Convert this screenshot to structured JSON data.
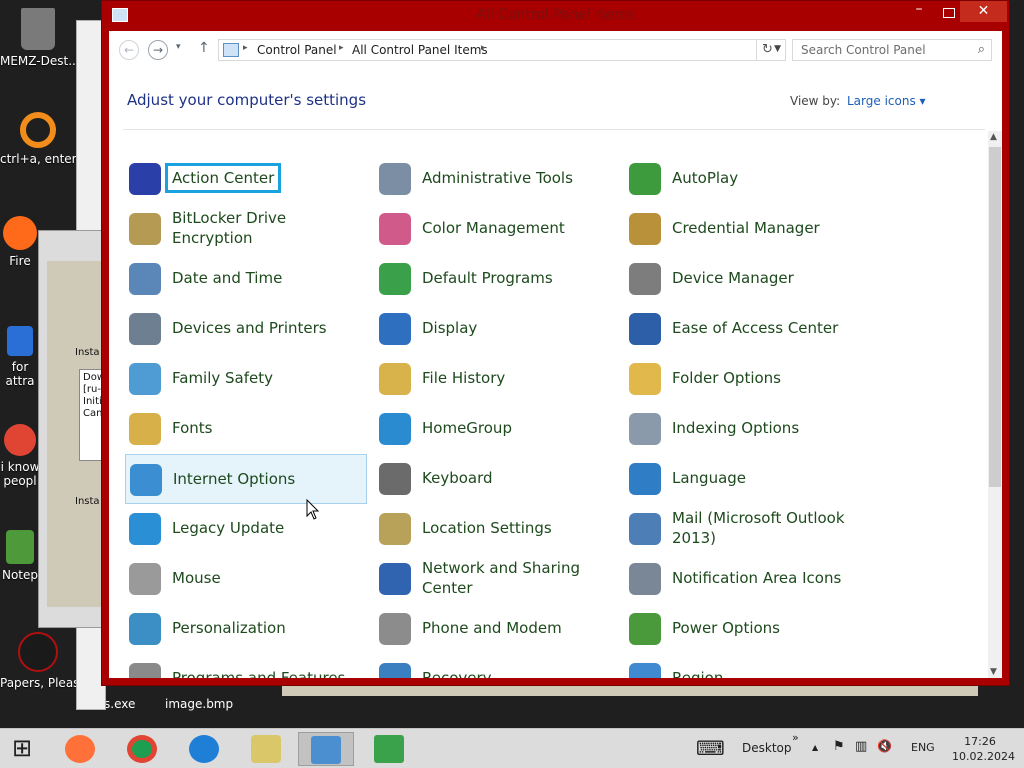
{
  "desktop": {
    "icons": [
      {
        "label": "MEMZ-Dest...",
        "color": "#7a7a7a"
      },
      {
        "label": "ctrl+a, enter",
        "color": "#f28c1b"
      },
      {
        "label": "Fire",
        "color": "#ff6a1a"
      },
      {
        "label": "for attra",
        "color": "#2a6fd6"
      },
      {
        "label": "i know peopl",
        "color": "#e04433"
      },
      {
        "label": "Notep",
        "color": "#4e9a3a"
      },
      {
        "label": "Papers, Please",
        "color": "#1a1a1a"
      }
    ],
    "bottom_files": [
      "s.exe",
      "image.bmp"
    ]
  },
  "installer": {
    "label_top": "Insta",
    "log_lines": [
      "Dow",
      "[ru-",
      "Initi",
      "Can"
    ],
    "label_bottom": "Insta"
  },
  "window": {
    "title": "All Control Panel Items",
    "close_glyph": "✕",
    "minimize_glyph": "–"
  },
  "nav": {
    "back_glyph": "←",
    "forward_glyph": "→",
    "recent_glyph": "▾",
    "up_glyph": "↑",
    "breadcrumbs": [
      "Control Panel",
      "All Control Panel Items"
    ],
    "refresh_glyph": "↻",
    "search_placeholder": "Search Control Panel",
    "search_glyph": "⌕"
  },
  "header": {
    "heading": "Adjust your computer's settings",
    "view_by_label": "View by:",
    "view_by_value": "Large icons ▾"
  },
  "items": [
    {
      "label": "Action Center",
      "color": "#2a3fa8"
    },
    {
      "label": "Administrative Tools",
      "color": "#7c8ea3"
    },
    {
      "label": "AutoPlay",
      "color": "#3d9a3d"
    },
    {
      "label": "BitLocker Drive Encryption",
      "color": "#b59a54"
    },
    {
      "label": "Color Management",
      "color": "#d05a8a"
    },
    {
      "label": "Credential Manager",
      "color": "#b8913a"
    },
    {
      "label": "Date and Time",
      "color": "#5b86b8"
    },
    {
      "label": "Default Programs",
      "color": "#3aa14a"
    },
    {
      "label": "Device Manager",
      "color": "#7d7d7d"
    },
    {
      "label": "Devices and Printers",
      "color": "#6e7f91"
    },
    {
      "label": "Display",
      "color": "#2e6fbf"
    },
    {
      "label": "Ease of Access Center",
      "color": "#2c5fa8"
    },
    {
      "label": "Family Safety",
      "color": "#4f9bd4"
    },
    {
      "label": "File History",
      "color": "#d8b24a"
    },
    {
      "label": "Folder Options",
      "color": "#e0b84c"
    },
    {
      "label": "Fonts",
      "color": "#d7b04a"
    },
    {
      "label": "HomeGroup",
      "color": "#2b8bd0"
    },
    {
      "label": "Indexing Options",
      "color": "#8a9aab"
    },
    {
      "label": "Internet Options",
      "color": "#3b8ed1"
    },
    {
      "label": "Keyboard",
      "color": "#6b6b6b"
    },
    {
      "label": "Language",
      "color": "#2f7dc4"
    },
    {
      "label": "Legacy Update",
      "color": "#2b8fd6"
    },
    {
      "label": "Location Settings",
      "color": "#b8a25a"
    },
    {
      "label": "Mail (Microsoft Outlook 2013)",
      "color": "#4d7fb6"
    },
    {
      "label": "Mouse",
      "color": "#9a9a9a"
    },
    {
      "label": "Network and Sharing Center",
      "color": "#3164b0"
    },
    {
      "label": "Notification Area Icons",
      "color": "#7a8796"
    },
    {
      "label": "Personalization",
      "color": "#3c8fc4"
    },
    {
      "label": "Phone and Modem",
      "color": "#8c8c8c"
    },
    {
      "label": "Power Options",
      "color": "#4a9a3c"
    },
    {
      "label": "Programs and Features",
      "color": "#8a8a8a"
    },
    {
      "label": "Recovery",
      "color": "#3a7fc0"
    },
    {
      "label": "Region",
      "color": "#3f8ad0"
    }
  ],
  "selection": {
    "focused": "Action Center",
    "hovered": "Internet Options"
  },
  "scrollbar": {
    "up_glyph": "▲",
    "down_glyph": "▼"
  },
  "taskbar": {
    "start_glyph": "⊞",
    "apps": [
      {
        "name": "Firefox",
        "color": "#ff7139"
      },
      {
        "name": "Chrome",
        "color": "#1e9e50"
      },
      {
        "name": "Edge",
        "color": "#1f7fd6"
      },
      {
        "name": "Explorer",
        "color": "#d9c76a"
      },
      {
        "name": "Control Panel",
        "color": "#4c8fd1"
      },
      {
        "name": "Installer",
        "color": "#3aa24a"
      }
    ],
    "keyboard_glyph": "⌨",
    "desktop_label": "Desktop",
    "overflow_glyph": "»",
    "tray_up_glyph": "▲",
    "flag_glyph": "⚑",
    "network_glyph": "▥",
    "volume_glyph": "🔇",
    "language": "ENG",
    "time": "17:26",
    "date": "10.02.2024"
  }
}
